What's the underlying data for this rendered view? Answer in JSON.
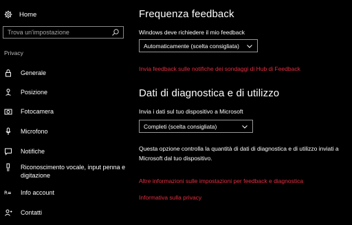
{
  "sidebar": {
    "home_label": "Home",
    "search_placeholder": "Trova un'impostazione",
    "section_label": "Privacy",
    "items": [
      {
        "label": "Generale",
        "icon": "lock-icon"
      },
      {
        "label": "Posizione",
        "icon": "location-icon"
      },
      {
        "label": "Fotocamera",
        "icon": "camera-icon"
      },
      {
        "label": "Microfono",
        "icon": "microphone-icon"
      },
      {
        "label": "Notifiche",
        "icon": "notification-icon"
      },
      {
        "label": "Riconoscimento vocale, input penna e digitazione",
        "icon": "speech-pen-icon"
      },
      {
        "label": "Info account",
        "icon": "account-info-icon"
      },
      {
        "label": "Contatti",
        "icon": "contacts-icon"
      }
    ]
  },
  "main": {
    "feedback": {
      "title": "Frequenza feedback",
      "question": "Windows deve richiedere il mio feedback",
      "dropdown_value": "Automaticamente (scelta consigliata)",
      "link": "Invia feedback sulle notifiche dei sondaggi di Hub di Feedback"
    },
    "diagnostics": {
      "title": "Dati di diagnostica e di utilizzo",
      "question": "Invia i dati sul tuo dispositivo a Microsoft",
      "dropdown_value": "Completi (scelta consigliata)",
      "description": "Questa opzione controlla la quantità di dati di diagnostica e di utilizzo inviati a Microsoft dal tuo dispositivo.",
      "link_more": "Altre informazioni sulle impostazioni per feedback e diagnostica",
      "link_privacy": "Informativa sulla privacy"
    }
  },
  "colors": {
    "background": "#000000",
    "text": "#ffffff",
    "accent_link": "#e62d40"
  }
}
